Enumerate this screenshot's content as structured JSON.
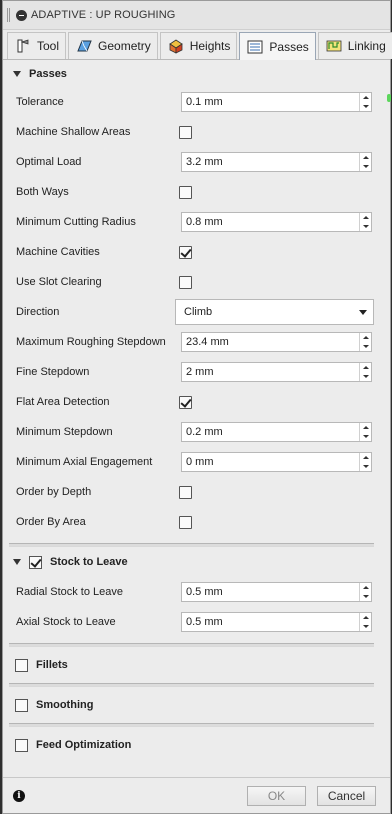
{
  "window": {
    "title": "ADAPTIVE : UP ROUGHING"
  },
  "tabs": [
    {
      "label": "Tool",
      "icon": "tool-icon"
    },
    {
      "label": "Geometry",
      "icon": "geometry-icon"
    },
    {
      "label": "Heights",
      "icon": "heights-icon"
    },
    {
      "label": "Passes",
      "icon": "passes-icon",
      "active": true
    },
    {
      "label": "Linking",
      "icon": "linking-icon"
    }
  ],
  "passes": {
    "header": "Passes",
    "tolerance": {
      "label": "Tolerance",
      "value": "0.1 mm"
    },
    "machine_shallow": {
      "label": "Machine Shallow Areas",
      "checked": false
    },
    "optimal_load": {
      "label": "Optimal Load",
      "value": "3.2 mm"
    },
    "both_ways": {
      "label": "Both Ways",
      "checked": false
    },
    "min_cutting_radius": {
      "label": "Minimum Cutting Radius",
      "value": "0.8 mm"
    },
    "machine_cavities": {
      "label": "Machine Cavities",
      "checked": true
    },
    "slot_clearing": {
      "label": "Use Slot Clearing",
      "checked": false
    },
    "direction": {
      "label": "Direction",
      "value": "Climb"
    },
    "max_stepdown": {
      "label": "Maximum Roughing Stepdown",
      "value": "23.4 mm"
    },
    "fine_stepdown": {
      "label": "Fine Stepdown",
      "value": "2 mm"
    },
    "flat_area": {
      "label": "Flat Area Detection",
      "checked": true
    },
    "min_stepdown": {
      "label": "Minimum Stepdown",
      "value": "0.2 mm"
    },
    "min_axial": {
      "label": "Minimum Axial Engagement",
      "value": "0 mm"
    },
    "order_depth": {
      "label": "Order by Depth",
      "checked": false
    },
    "order_area": {
      "label": "Order By Area",
      "checked": false
    }
  },
  "stock": {
    "header": "Stock to Leave",
    "checked": true,
    "radial": {
      "label": "Radial Stock to Leave",
      "value": "0.5 mm"
    },
    "axial": {
      "label": "Axial Stock to Leave",
      "value": "0.5 mm"
    }
  },
  "fillets": {
    "label": "Fillets",
    "checked": false
  },
  "smoothing": {
    "label": "Smoothing",
    "checked": false
  },
  "feed_opt": {
    "label": "Feed Optimization",
    "checked": false
  },
  "footer": {
    "ok": "OK",
    "cancel": "Cancel",
    "info_glyph": "i"
  }
}
